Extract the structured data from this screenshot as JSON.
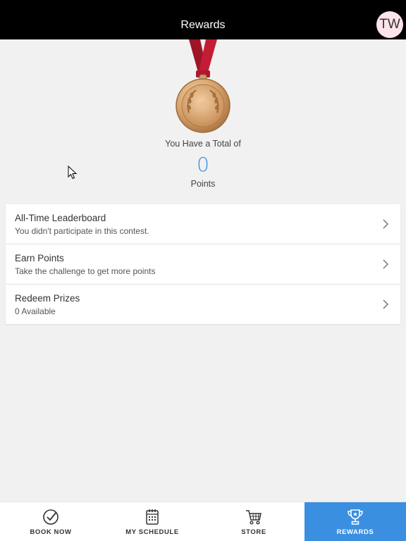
{
  "header": {
    "title": "Rewards",
    "avatar_initials": "TW"
  },
  "points": {
    "caption": "You Have a Total of",
    "value": "0",
    "unit": "Points"
  },
  "menu": [
    {
      "title": "All-Time Leaderboard",
      "subtitle": "You didn't participate in this contest."
    },
    {
      "title": "Earn Points",
      "subtitle": "Take the challenge to get more points"
    },
    {
      "title": "Redeem Prizes",
      "subtitle": "0 Available"
    }
  ],
  "tabs": [
    {
      "label": "BOOK NOW",
      "icon": "check-circle-icon"
    },
    {
      "label": "MY SCHEDULE",
      "icon": "calendar-icon"
    },
    {
      "label": "STORE",
      "icon": "cart-icon"
    },
    {
      "label": "REWARDS",
      "icon": "trophy-icon",
      "active": true
    }
  ],
  "colors": {
    "header_bg": "#000000",
    "accent": "#3a8fe0",
    "ribbon": "#b0182e",
    "medal": "#c9925a",
    "avatar_bg": "#fde4ea"
  }
}
